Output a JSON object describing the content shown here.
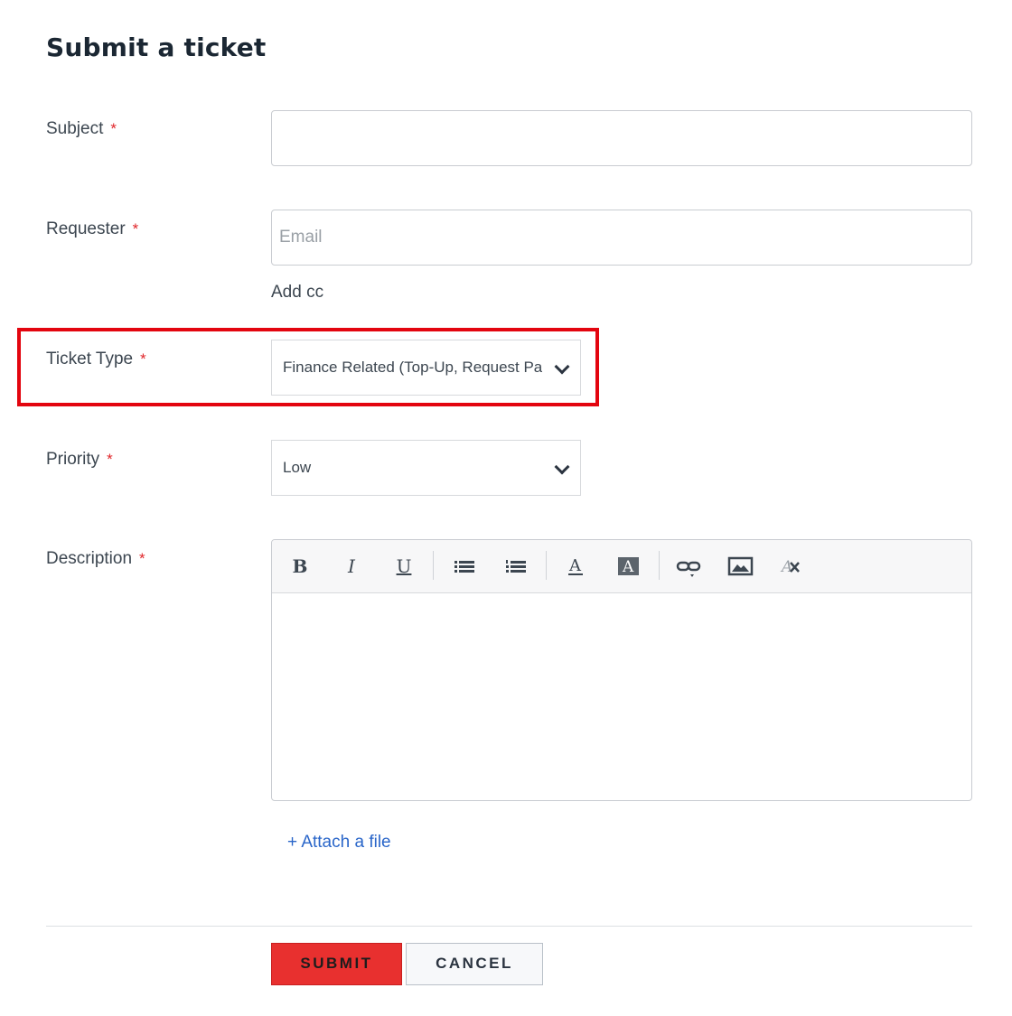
{
  "title": "Submit a ticket",
  "required_marker": "*",
  "fields": {
    "subject": {
      "label": "Subject",
      "value": ""
    },
    "requester": {
      "label": "Requester",
      "placeholder": "Email",
      "add_cc": "Add cc"
    },
    "ticket_type": {
      "label": "Ticket Type",
      "selected": "Finance Related (Top-Up, Request Payment, etc.)"
    },
    "priority": {
      "label": "Priority",
      "selected": "Low"
    },
    "description": {
      "label": "Description",
      "value": ""
    }
  },
  "toolbar": {
    "bold": "B",
    "italic": "I",
    "underline": "U",
    "icons": [
      "bold-icon",
      "italic-icon",
      "underline-icon",
      "bullet-list-icon",
      "numbered-list-icon",
      "font-color-icon",
      "background-color-icon",
      "link-icon",
      "image-icon",
      "clear-format-icon"
    ]
  },
  "attach_label": "+ Attach a file",
  "buttons": {
    "submit": "SUBMIT",
    "cancel": "CANCEL"
  },
  "colors": {
    "accent_red": "#e8302f",
    "highlight_red": "#e3050f",
    "link_blue": "#2a66c9",
    "required_star": "#e0262a"
  }
}
